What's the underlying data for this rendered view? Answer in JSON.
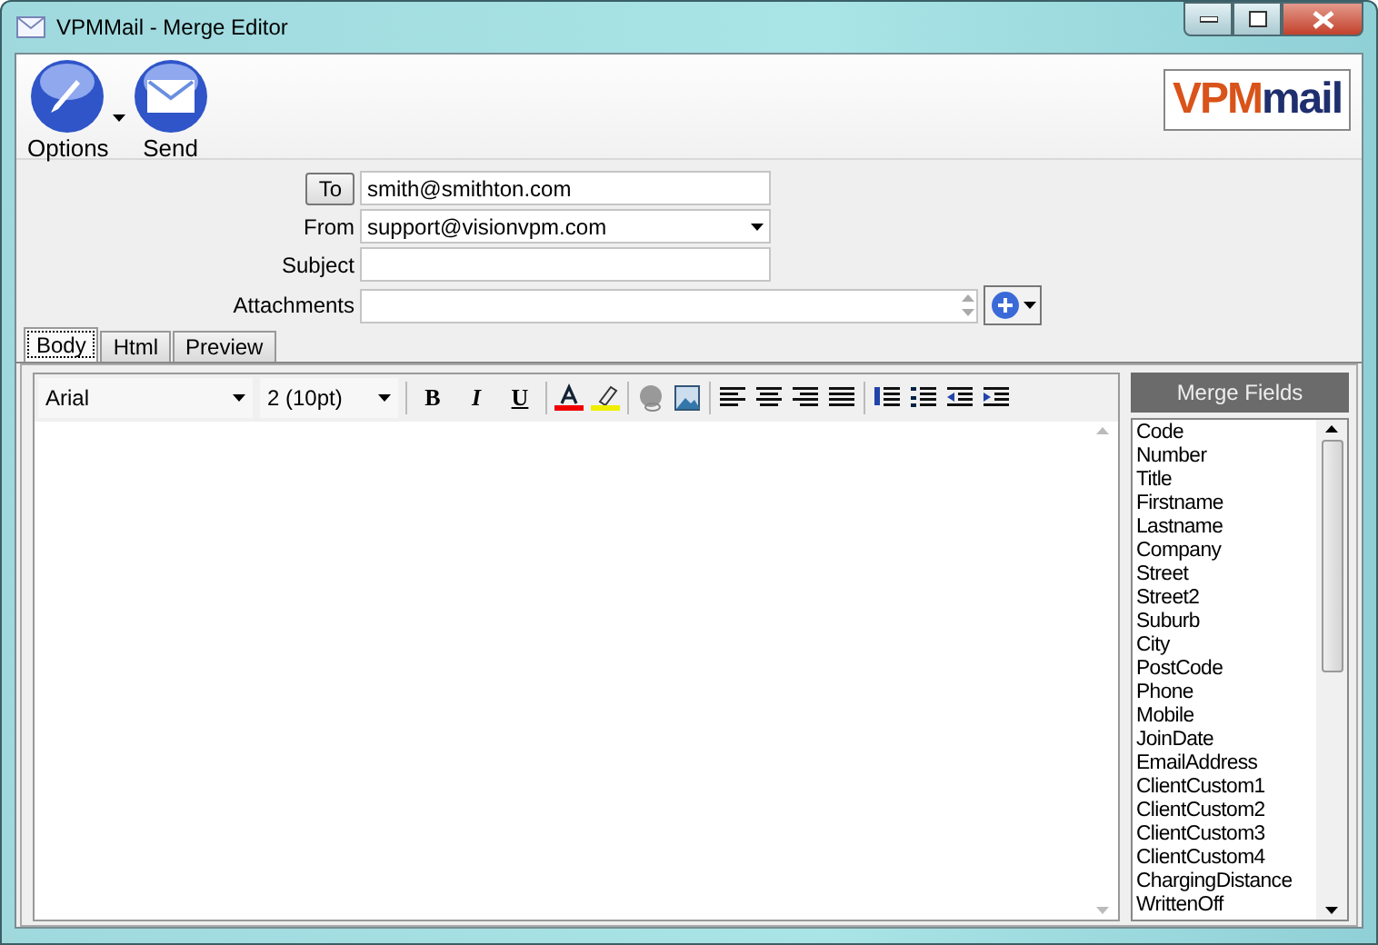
{
  "window": {
    "title": "VPMMail - Merge Editor"
  },
  "toolbar": {
    "buttons": [
      {
        "label": "Options",
        "kind": "options",
        "has_menu": true
      },
      {
        "label": "Send",
        "kind": "send",
        "has_menu": false
      }
    ]
  },
  "logo": {
    "accent": "VPM",
    "rest": "mail"
  },
  "form": {
    "to_button": "To",
    "to_value": "smith@smithton.com",
    "fields": [
      {
        "label": "From",
        "kind": "dropdown",
        "value": "support@visionvpm.com"
      },
      {
        "label": "Subject",
        "kind": "text"
      },
      {
        "label": "Attachments",
        "kind": "list"
      }
    ]
  },
  "tabs": [
    {
      "label": "Body",
      "selected": true
    },
    {
      "label": "Html",
      "selected": false
    },
    {
      "label": "Preview",
      "selected": false
    }
  ],
  "editor": {
    "font": "Arial",
    "size": "2 (10pt)",
    "format_buttons": [
      "B",
      "I",
      "U"
    ]
  },
  "merge_fields": {
    "title": "Merge Fields",
    "items": [
      "Code",
      "Number",
      "Title",
      "Firstname",
      "Lastname",
      "Company",
      "Street",
      "Street2",
      "Suburb",
      "City",
      "PostCode",
      "Phone",
      "Mobile",
      "JoinDate",
      "EmailAddress",
      "ClientCustom1",
      "ClientCustom2",
      "ClientCustom3",
      "ClientCustom4",
      "ChargingDistance",
      "WrittenOff"
    ]
  }
}
